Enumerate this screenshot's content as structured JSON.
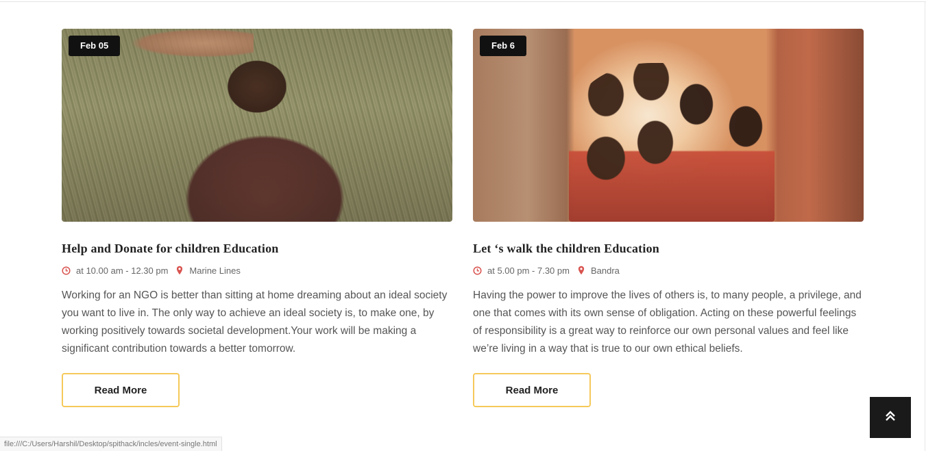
{
  "colors": {
    "accent_yellow": "#f5c95a",
    "icon_red": "#d9534f",
    "badge_bg": "#111111",
    "back_to_top_bg": "#1a1a1a"
  },
  "events": [
    {
      "date": "Feb 05",
      "image_desc": "child playing in grass",
      "title": "Help and Donate for children Education",
      "time": "at 10.00 am - 12.30 pm",
      "location": "Marine Lines",
      "description": "Working for an NGO is better than sitting at home dreaming about an ideal society you want to live in. The only way to achieve an ideal society is, to make one, by working positively towards societal development.Your work will be making a significant contribution towards a better tomorrow.",
      "button_label": "Read More"
    },
    {
      "date": "Feb 6",
      "image_desc": "group of children at a doorway",
      "title": "Let ‘s walk the children Education",
      "time": "at 5.00 pm - 7.30 pm",
      "location": "Bandra",
      "description": "Having the power to improve the lives of others is, to many people, a privilege, and one that comes with its own sense of obligation. Acting on these powerful feelings of responsibility is a great way to reinforce our own personal values and feel like we’re living in a way that is true to our own ethical beliefs.",
      "button_label": "Read More"
    }
  ],
  "back_to_top": {
    "icon": "double-chevron-up-icon"
  },
  "status_bar": {
    "url": "file:///C:/Users/Harshil/Desktop/spithack/incles/event-single.html"
  }
}
